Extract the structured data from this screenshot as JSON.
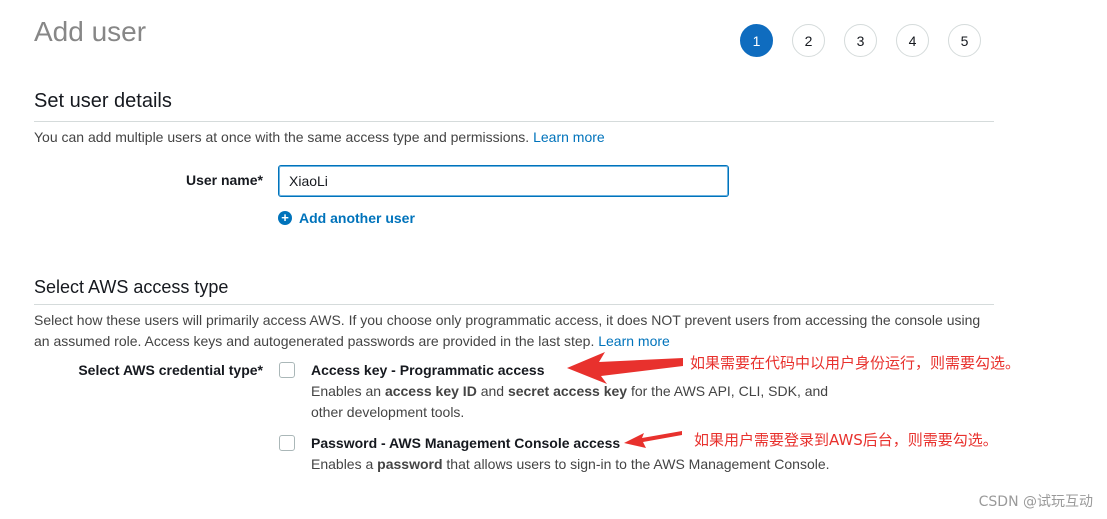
{
  "page": {
    "title": "Add user"
  },
  "steps": [
    "1",
    "2",
    "3",
    "4",
    "5"
  ],
  "active_step": "1",
  "details_section": {
    "title": "Set user details",
    "description": "You can add multiple users at once with the same access type and permissions.",
    "learn_more": "Learn more",
    "username_label": "User name*",
    "username_value": "XiaoLi",
    "add_another": "Add another user"
  },
  "access_section": {
    "title": "Select AWS access type",
    "description": "Select how these users will primarily access AWS. If you choose only programmatic access, it does NOT prevent users from accessing the console using an assumed role. Access keys and autogenerated passwords are provided in the last step.",
    "learn_more": "Learn more",
    "credential_label": "Select AWS credential type*",
    "options": [
      {
        "title": "Access key - Programmatic access",
        "desc_1": "Enables an ",
        "desc_b1": "access key ID",
        "desc_2": " and ",
        "desc_b2": "secret access key",
        "desc_3": " for the AWS API, CLI, SDK, and other development tools.",
        "checked": false
      },
      {
        "title": "Password - AWS Management Console access",
        "desc_1": "Enables a ",
        "desc_b1": "password",
        "desc_2": " that allows users to sign-in to the AWS Management Console.",
        "checked": false
      }
    ]
  },
  "annotations": {
    "note_1": "如果需要在代码中以用户身份运行，则需要勾选。",
    "note_2": "如果用户需要登录到AWS后台，则需要勾选。",
    "color": "#e8312d"
  },
  "watermark": "CSDN @试玩互动",
  "colors": {
    "accent": "#0f6cbf",
    "link": "#0073bb"
  }
}
